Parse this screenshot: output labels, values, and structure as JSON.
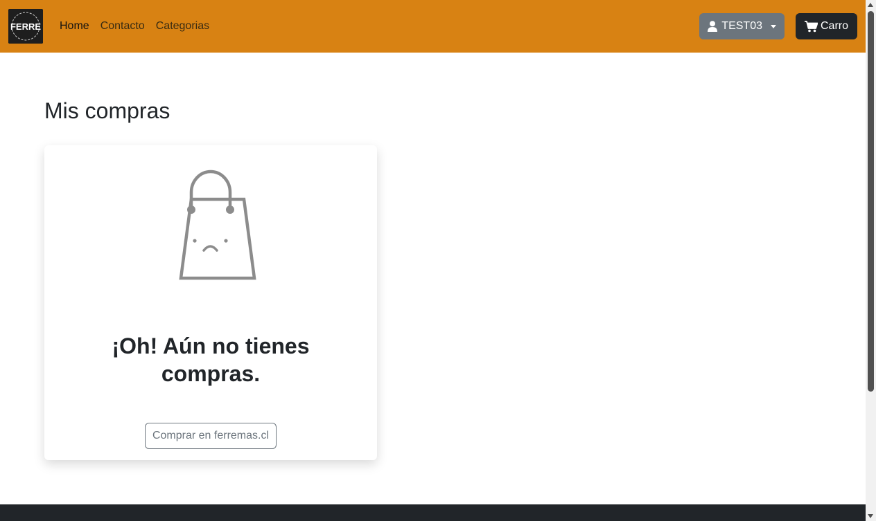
{
  "navbar": {
    "brand_text": "FERRE",
    "links": [
      {
        "label": "Home",
        "active": true
      },
      {
        "label": "Contacto",
        "active": false
      },
      {
        "label": "Categorias",
        "active": false
      }
    ],
    "user_label": "TEST03",
    "cart_label": "Carro",
    "background_color": "#d88213"
  },
  "main": {
    "title": "Mis compras",
    "empty_message": "¡Oh! Aún no tienes compras.",
    "shop_button_label": "Comprar en ferremas.cl"
  },
  "icons": {
    "logo": "ferre-logo-icon",
    "user": "user-icon",
    "dropdown": "caret-down-icon",
    "cart": "cart-icon",
    "illustration": "sad-shopping-bag-icon"
  }
}
